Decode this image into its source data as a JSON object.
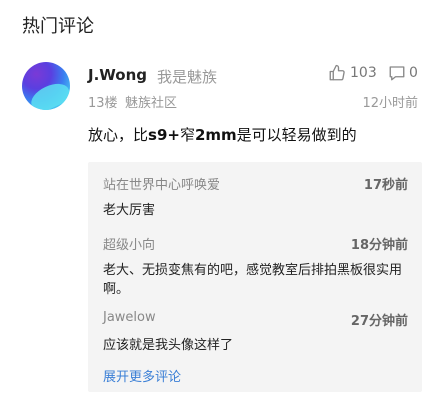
{
  "section_title": "热门评论",
  "comment": {
    "user_name": "J.Wong",
    "user_tag": "我是魅族",
    "floor": "13楼",
    "source": "魅族社区",
    "time": "12小时前",
    "likes": "103",
    "replies_count": "0",
    "text_prefix": "放心，比",
    "text_bold1": "s9+",
    "text_mid": "窄",
    "text_bold2": "2mm",
    "text_suffix": "是可以轻易做到的"
  },
  "replies": [
    {
      "name": "站在世界中心呼唤爱",
      "time": "17秒前",
      "text": "老大厉害"
    },
    {
      "name": "超级小向",
      "time": "18分钟前",
      "text": "老大、无损变焦有的吧，感觉教室后排拍黑板很实用啊。"
    },
    {
      "name": "Jawelow",
      "time": "27分钟前",
      "text": "应该就是我头像这样了"
    }
  ],
  "more_label": "展开更多评论"
}
